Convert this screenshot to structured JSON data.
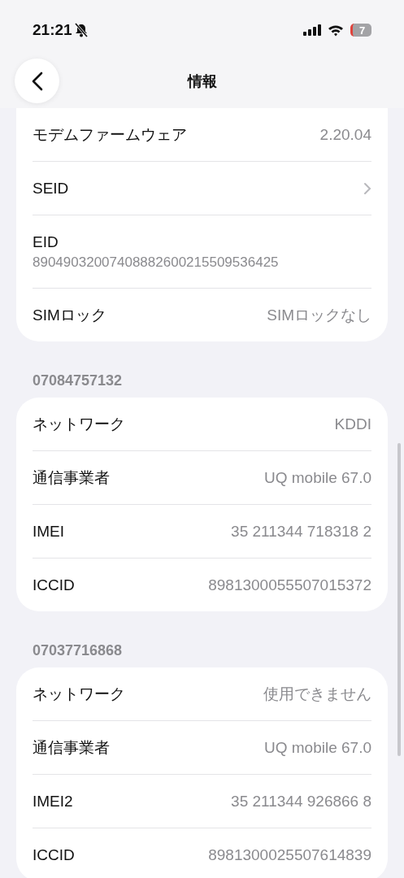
{
  "status_bar": {
    "time": "21:21",
    "battery": "7"
  },
  "nav": {
    "title": "情報"
  },
  "sections": [
    {
      "rows": [
        {
          "kind": "value",
          "label": "モデムファームウェア",
          "value": "2.20.04"
        },
        {
          "kind": "chevron",
          "label": "SEID"
        },
        {
          "kind": "stacked",
          "label": "EID",
          "value": "89049032007408882600215509536425"
        },
        {
          "kind": "value",
          "label": "SIMロック",
          "value": "SIMロックなし"
        }
      ]
    },
    {
      "header": "07084757132",
      "rows": [
        {
          "kind": "value",
          "label": "ネットワーク",
          "value": "KDDI"
        },
        {
          "kind": "value",
          "label": "通信事業者",
          "value": "UQ mobile 67.0"
        },
        {
          "kind": "value",
          "label": "IMEI",
          "value": "35 211344 718318 2"
        },
        {
          "kind": "value",
          "label": "ICCID",
          "value": "8981300055507015372"
        }
      ]
    },
    {
      "header": "07037716868",
      "rows": [
        {
          "kind": "value",
          "label": "ネットワーク",
          "value": "使用できません"
        },
        {
          "kind": "value",
          "label": "通信事業者",
          "value": "UQ mobile 67.0"
        },
        {
          "kind": "value",
          "label": "IMEI2",
          "value": "35 211344 926866 8"
        },
        {
          "kind": "value",
          "label": "ICCID",
          "value": "8981300025507614839"
        }
      ]
    }
  ]
}
